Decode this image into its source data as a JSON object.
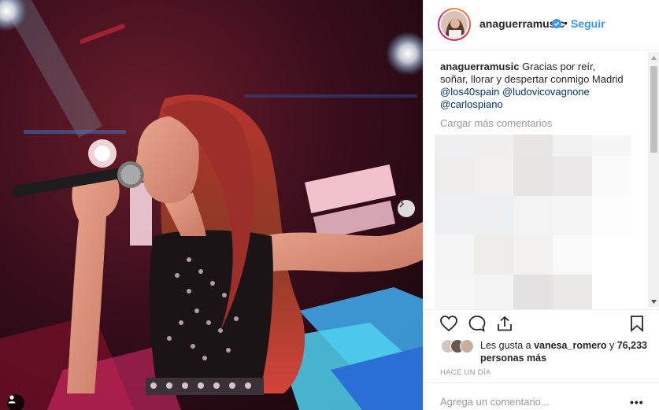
{
  "post": {
    "username": "anaguerramusic",
    "separator": "•",
    "follow_label": "Seguir",
    "caption_text": "Gracias por reír, soñar, llorar y despertar conmigo Madrid",
    "mentions": [
      "@los40spain",
      "@ludovicovagnone",
      "@carlospiano"
    ],
    "load_more": "Cargar más comentarios",
    "likes_prefix": "Les gusta a ",
    "likes_user": "vanesa_romero",
    "likes_middle": " y ",
    "likes_count": "76,233 personas más",
    "timestamp": "HACE UN DÍA",
    "comment_placeholder": "Agrega un comentario...",
    "more_label": "•••"
  },
  "icons": {
    "verified": "verified-badge-icon",
    "like": "heart-icon",
    "comment": "comment-icon",
    "share": "share-icon",
    "save": "bookmark-icon",
    "next": "chevron-right-icon",
    "tag": "user-tag-icon"
  },
  "colors": {
    "link": "#3897f0",
    "mention": "#003569",
    "muted": "#999999",
    "text": "#262626"
  }
}
